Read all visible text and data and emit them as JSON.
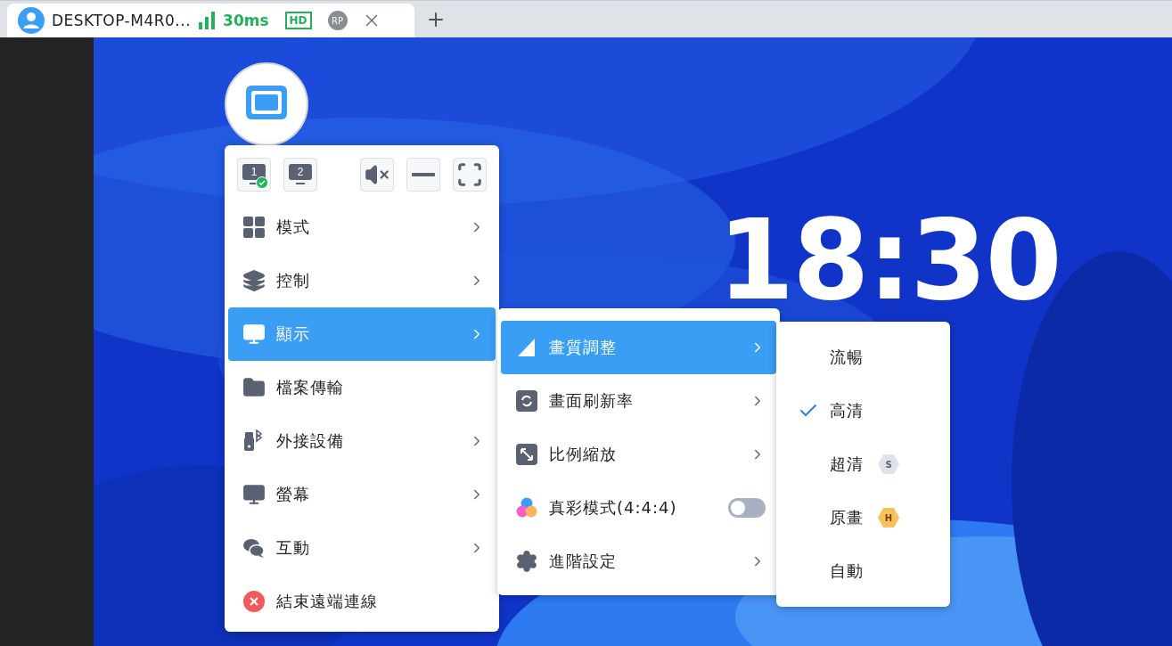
{
  "tab": {
    "title": "DESKTOP-M4R0...",
    "latency": "30ms",
    "quality": "HD",
    "avatar": "RP"
  },
  "clock": "18:30",
  "toolbar": [
    {
      "kind": "screen",
      "label": "1",
      "selected": true
    },
    {
      "kind": "screen",
      "label": "2",
      "selected": false
    },
    {
      "kind": "mute"
    },
    {
      "kind": "minimize"
    },
    {
      "kind": "fullscreen"
    }
  ],
  "main_menu": [
    {
      "kind": "grid",
      "label": "模式",
      "has_submenu": true,
      "selected": false
    },
    {
      "kind": "layers",
      "label": "控制",
      "has_submenu": true,
      "selected": false
    },
    {
      "kind": "monitor",
      "label": "顯示",
      "has_submenu": true,
      "selected": true
    },
    {
      "kind": "folder",
      "label": "檔案傳輸",
      "has_submenu": false,
      "selected": false
    },
    {
      "kind": "usb",
      "label": "外接設備",
      "has_submenu": true,
      "selected": false
    },
    {
      "kind": "monitor",
      "label": "螢幕",
      "has_submenu": true,
      "selected": false
    },
    {
      "kind": "chat",
      "label": "互動",
      "has_submenu": true,
      "selected": false
    },
    {
      "kind": "close",
      "label": "結束遠端連線",
      "has_submenu": false,
      "selected": false
    }
  ],
  "display_menu": [
    {
      "kind": "quality",
      "label": "畫質調整",
      "has_submenu": true,
      "selected": true
    },
    {
      "kind": "refresh",
      "label": "畫面刷新率",
      "has_submenu": true,
      "selected": false
    },
    {
      "kind": "scale",
      "label": "比例縮放",
      "has_submenu": true,
      "selected": false
    },
    {
      "kind": "color",
      "label": "真彩模式(4:4:4)",
      "on": false,
      "has_submenu": false,
      "selected": false
    },
    {
      "kind": "gear",
      "label": "進階設定",
      "has_submenu": true,
      "selected": false
    }
  ],
  "quality_menu": [
    {
      "label": "流暢",
      "checked": false
    },
    {
      "label": "高清",
      "checked": true
    },
    {
      "label": "超清",
      "checked": false,
      "badge": "S",
      "kind": "silver"
    },
    {
      "label": "原畫",
      "checked": false,
      "badge": "H",
      "kind": "gold"
    },
    {
      "label": "自動",
      "checked": false
    }
  ]
}
